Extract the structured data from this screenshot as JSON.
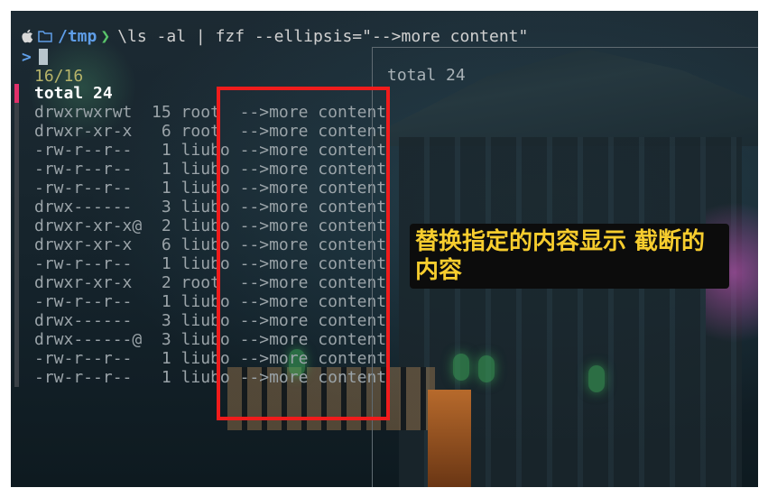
{
  "terminal": {
    "prompt": {
      "icon_apple": "apple-icon",
      "icon_folder": "folder-icon",
      "path": "/tmp",
      "chevron": "❯",
      "command": "\\ls -al",
      "pipe": " | ",
      "fzf_command": "fzf --ellipsis=\"-->more content\""
    },
    "input": {
      "marker": ">",
      "value": ""
    },
    "match_count": "16/16",
    "rows": [
      "total 24",
      "drwxrwxrwt  15 root  -->more content",
      "drwxr-xr-x   6 root  -->more content",
      "-rw-r--r--   1 liubo -->more content",
      "-rw-r--r--   1 liubo -->more content",
      "-rw-r--r--   1 liubo -->more content",
      "drwx------   3 liubo -->more content",
      "drwxr-xr-x@  2 liubo -->more content",
      "drwxr-xr-x   6 liubo -->more content",
      "-rw-r--r--   1 liubo -->more content",
      "drwxr-xr-x   2 root  -->more content",
      "-rw-r--r--   1 liubo -->more content",
      "drwx------   3 liubo -->more content",
      "drwx------@  3 liubo -->more content",
      "-rw-r--r--   1 liubo -->more content",
      "-rw-r--r--   1 liubo -->more content"
    ],
    "selected_index": 0,
    "preview_text": "total 24"
  },
  "annotation": {
    "callout_text": "替换指定的内容显示 截断的内容",
    "box_color": "#f01c1c",
    "text_color": "#f7cd2e"
  }
}
